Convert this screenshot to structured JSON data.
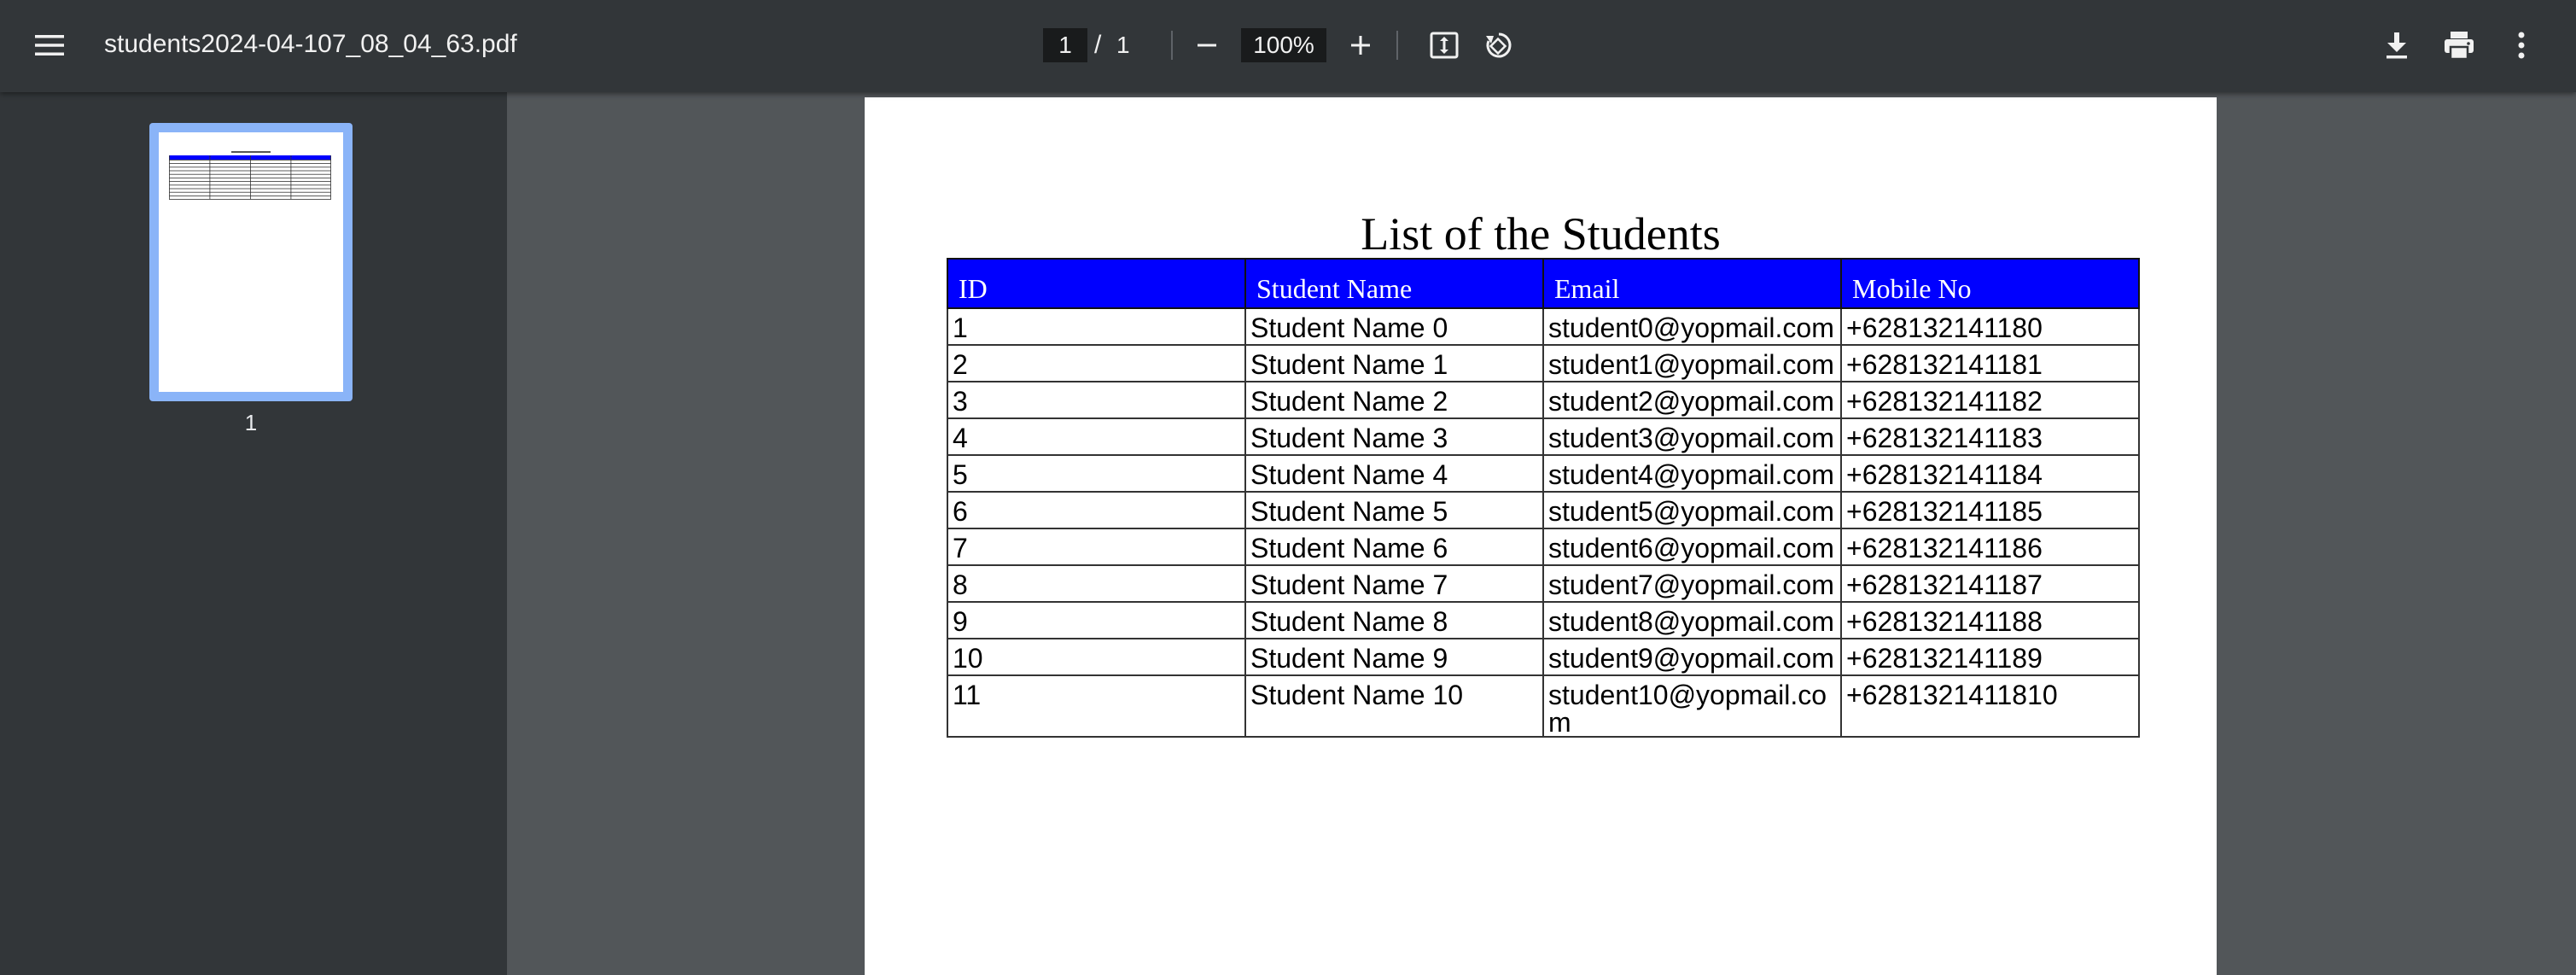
{
  "toolbar": {
    "file_name": "students2024-04-107_08_04_63.pdf",
    "current_page": "1",
    "page_separator": "/",
    "total_pages": "1",
    "zoom": "100%"
  },
  "sidebar": {
    "thumbnail_label": "1"
  },
  "document": {
    "title": "List of the Students",
    "columns": [
      "ID",
      "Student Name",
      "Email",
      "Mobile No"
    ],
    "rows": [
      [
        "1",
        "Student Name 0",
        "student0@yopmail.com",
        "+628132141180"
      ],
      [
        "2",
        "Student Name 1",
        "student1@yopmail.com",
        "+628132141181"
      ],
      [
        "3",
        "Student Name 2",
        "student2@yopmail.com",
        "+628132141182"
      ],
      [
        "4",
        "Student Name 3",
        "student3@yopmail.com",
        "+628132141183"
      ],
      [
        "5",
        "Student Name 4",
        "student4@yopmail.com",
        "+628132141184"
      ],
      [
        "6",
        "Student Name 5",
        "student5@yopmail.com",
        "+628132141185"
      ],
      [
        "7",
        "Student Name 6",
        "student6@yopmail.com",
        "+628132141186"
      ],
      [
        "8",
        "Student Name 7",
        "student7@yopmail.com",
        "+628132141187"
      ],
      [
        "9",
        "Student Name 8",
        "student8@yopmail.com",
        "+628132141188"
      ],
      [
        "10",
        "Student Name 9",
        "student9@yopmail.com",
        "+628132141189"
      ],
      [
        "11",
        "Student Name 10",
        "student10@yopmail.com",
        "+6281321411810"
      ]
    ]
  },
  "colors": {
    "toolbar_bg": "#323639",
    "viewer_bg": "#525659",
    "table_header_bg": "#0000ff",
    "thumbnail_highlight": "#8ab4f8"
  },
  "icons": {
    "menu": "menu-icon",
    "zoom_out": "minus-icon",
    "zoom_in": "plus-icon",
    "fit_page": "fit-page-icon",
    "rotate": "rotate-icon",
    "download": "download-icon",
    "print": "print-icon",
    "more": "more-vert-icon"
  }
}
